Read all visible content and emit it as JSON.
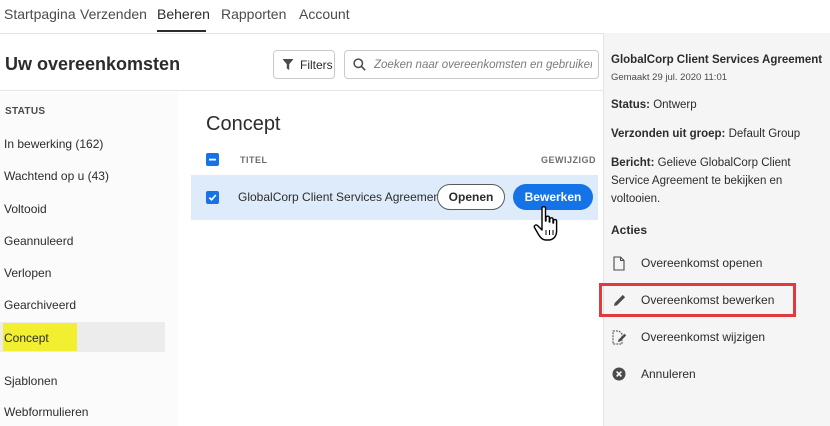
{
  "topnav": {
    "tabs": [
      "Startpagina",
      "Verzenden",
      "Beheren",
      "Rapporten",
      "Account"
    ],
    "active": "Beheren"
  },
  "header": {
    "title": "Uw overeenkomsten",
    "filters_label": "Filters",
    "search_placeholder": "Zoeken naar overeenkomsten en gebruikers..."
  },
  "sidebar": {
    "status_label": "STATUS",
    "items": [
      "In bewerking (162)",
      "Wachtend op u (43)",
      "Voltooid",
      "Geannuleerd",
      "Verlopen",
      "Gearchiveerd",
      "Concept",
      "Sjablonen",
      "Webformulieren"
    ],
    "active": "Concept",
    "highlight_color": "#f1ef30"
  },
  "main": {
    "heading": "Concept",
    "col_title": "TITEL",
    "col_modified": "GEWIJZIGD",
    "rows": [
      {
        "name": "GlobalCorp Client Services Agreement",
        "checked": true,
        "open_label": "Openen",
        "edit_label": "Bewerken"
      }
    ]
  },
  "details": {
    "title": "GlobalCorp Client Services Agreement",
    "created": "Gemaakt 29 jul. 2020 11:01",
    "status_label": "Status:",
    "status_value": "Ontwerp",
    "group_label": "Verzonden uit groep:",
    "group_value": "Default Group",
    "message_label": "Bericht:",
    "message_value": "Gelieve GlobalCorp Client Service Agreement te bekijken en voltooien.",
    "actions_label": "Acties",
    "actions": [
      {
        "label": "Overeenkomst openen",
        "icon": "document-icon"
      },
      {
        "label": "Overeenkomst bewerken",
        "icon": "pencil-icon"
      },
      {
        "label": "Overeenkomst wijzigen",
        "icon": "edit-document-icon"
      },
      {
        "label": "Annuleren",
        "icon": "cancel-circle-icon"
      }
    ]
  },
  "colors": {
    "accent": "#1473e6",
    "row_selected": "#deebfa",
    "annotation_red": "#e2393c"
  }
}
